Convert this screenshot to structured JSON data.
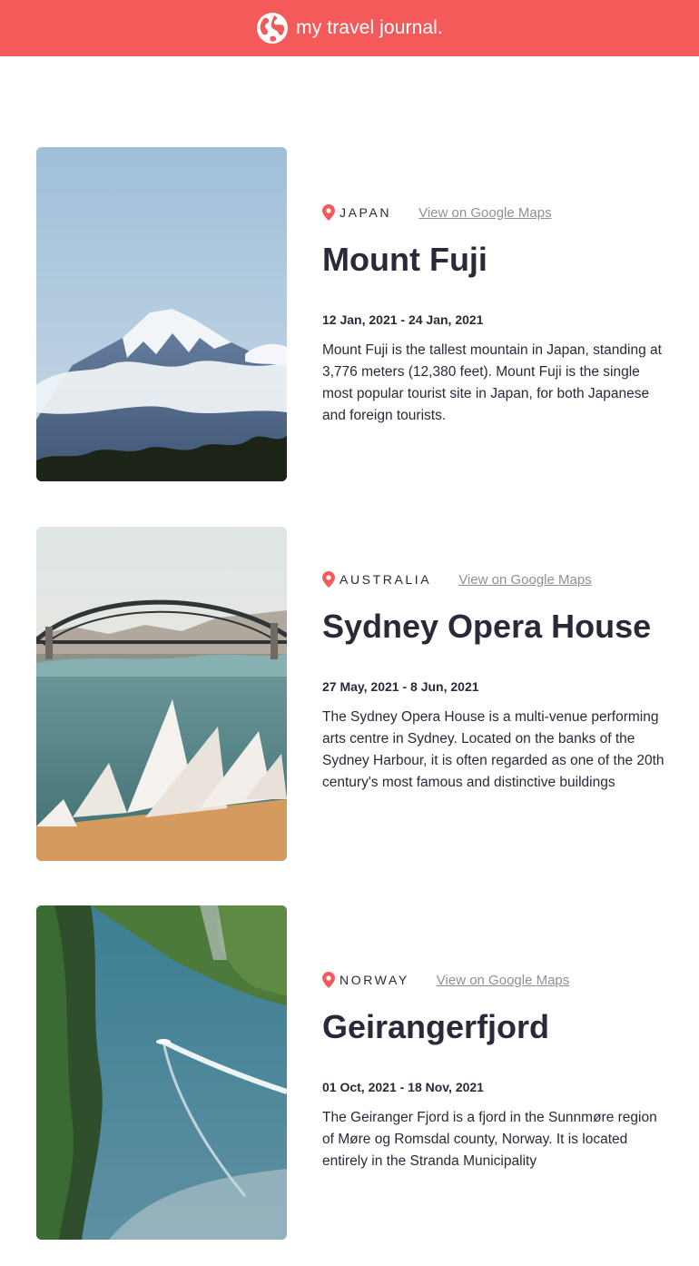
{
  "header": {
    "title": "my travel journal.",
    "icon": "globe-icon",
    "background_color": "#F55A5A"
  },
  "entries": [
    {
      "country": "JAPAN",
      "maps_link_label": "View on Google Maps",
      "title": "Mount Fuji",
      "dates": "12 Jan, 2021 - 24 Jan, 2021",
      "description": "Mount Fuji is the tallest mountain in Japan, standing at 3,776 meters (12,380 feet). Mount Fuji is the single most popular tourist site in Japan, for both Japanese and foreign tourists."
    },
    {
      "country": "AUSTRALIA",
      "maps_link_label": "View on Google Maps",
      "title": "Sydney Opera House",
      "dates": "27 May, 2021 - 8 Jun, 2021",
      "description": "The Sydney Opera House is a multi-venue performing arts centre in Sydney. Located on the banks of the Sydney Harbour, it is often regarded as one of the 20th century's most famous and distinctive buildings"
    },
    {
      "country": "NORWAY",
      "maps_link_label": "View on Google Maps",
      "title": "Geirangerfjord",
      "dates": "01 Oct, 2021 - 18 Nov, 2021",
      "description": "The Geiranger Fjord is a fjord in the Sunnmøre region of Møre og Romsdal county, Norway. It is located entirely in the Stranda Municipality"
    }
  ]
}
